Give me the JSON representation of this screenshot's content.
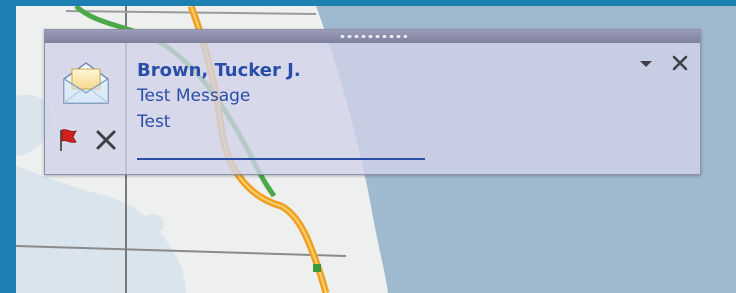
{
  "alert": {
    "sender": "Brown, Tucker J.",
    "subject": "Test Message",
    "preview": "Test"
  },
  "icons": {
    "envelope": "envelope-icon",
    "flag": "flag-icon",
    "delete": "delete-x-icon",
    "options": "dropdown-arrow-icon",
    "close": "close-x-icon"
  },
  "colors": {
    "text_accent": "#2a4ea8",
    "popup_background": "#d1d3e9",
    "grip_bar": "#8d90ab",
    "flag_red": "#d02020",
    "desktop_border": "#1e7fb3"
  }
}
